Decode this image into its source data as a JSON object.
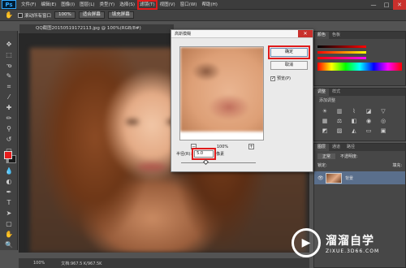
{
  "menubar": {
    "logo": "Ps",
    "items": [
      {
        "label": "文件(F)"
      },
      {
        "label": "编辑(E)"
      },
      {
        "label": "图像(I)"
      },
      {
        "label": "图层(L)"
      },
      {
        "label": "类型(Y)"
      },
      {
        "label": "选择(S)"
      },
      {
        "label": "滤镜(T)",
        "highlighted": true
      },
      {
        "label": "视图(V)"
      },
      {
        "label": "窗口(W)"
      },
      {
        "label": "帮助(H)"
      }
    ],
    "win_controls": [
      "—",
      "□",
      "✕"
    ]
  },
  "options": {
    "tool_icon": "hand-icon",
    "scroll_all_windows": "滚动所有窗口",
    "zoom_100": "100%",
    "fit_screen": "适合屏幕",
    "fill_screen": "填充屏幕"
  },
  "document": {
    "tab_title": "QQ截图20150519172113.jpg @ 100%(RGB/8#)",
    "status_zoom": "100%",
    "status_doc": "文档:967.5 K/967.5K"
  },
  "panels": {
    "color_tabs": [
      "颜色",
      "色板"
    ],
    "adjust_tabs": [
      "调整",
      "样式"
    ],
    "adjust_title": "添加调整",
    "layers_tabs": [
      "图层",
      "通道",
      "路径"
    ],
    "blend_mode": "正常",
    "opacity_label": "不透明度:",
    "lock_label": "锁定:",
    "fill_label": "填充:",
    "layer_name": "背景"
  },
  "dialog": {
    "title": "高斯模糊",
    "close": "✕",
    "ok": "确定",
    "cancel": "取消",
    "preview_label": "预览(P)",
    "preview_checked": true,
    "zoom_minus": "−",
    "zoom_value": "100%",
    "zoom_plus": "+",
    "radius_label": "半径(R):",
    "radius_value": "5.0",
    "radius_unit": "像素"
  },
  "watermark": {
    "cn": "溜溜自学",
    "url": "ZIXUE.3D66.COM"
  }
}
